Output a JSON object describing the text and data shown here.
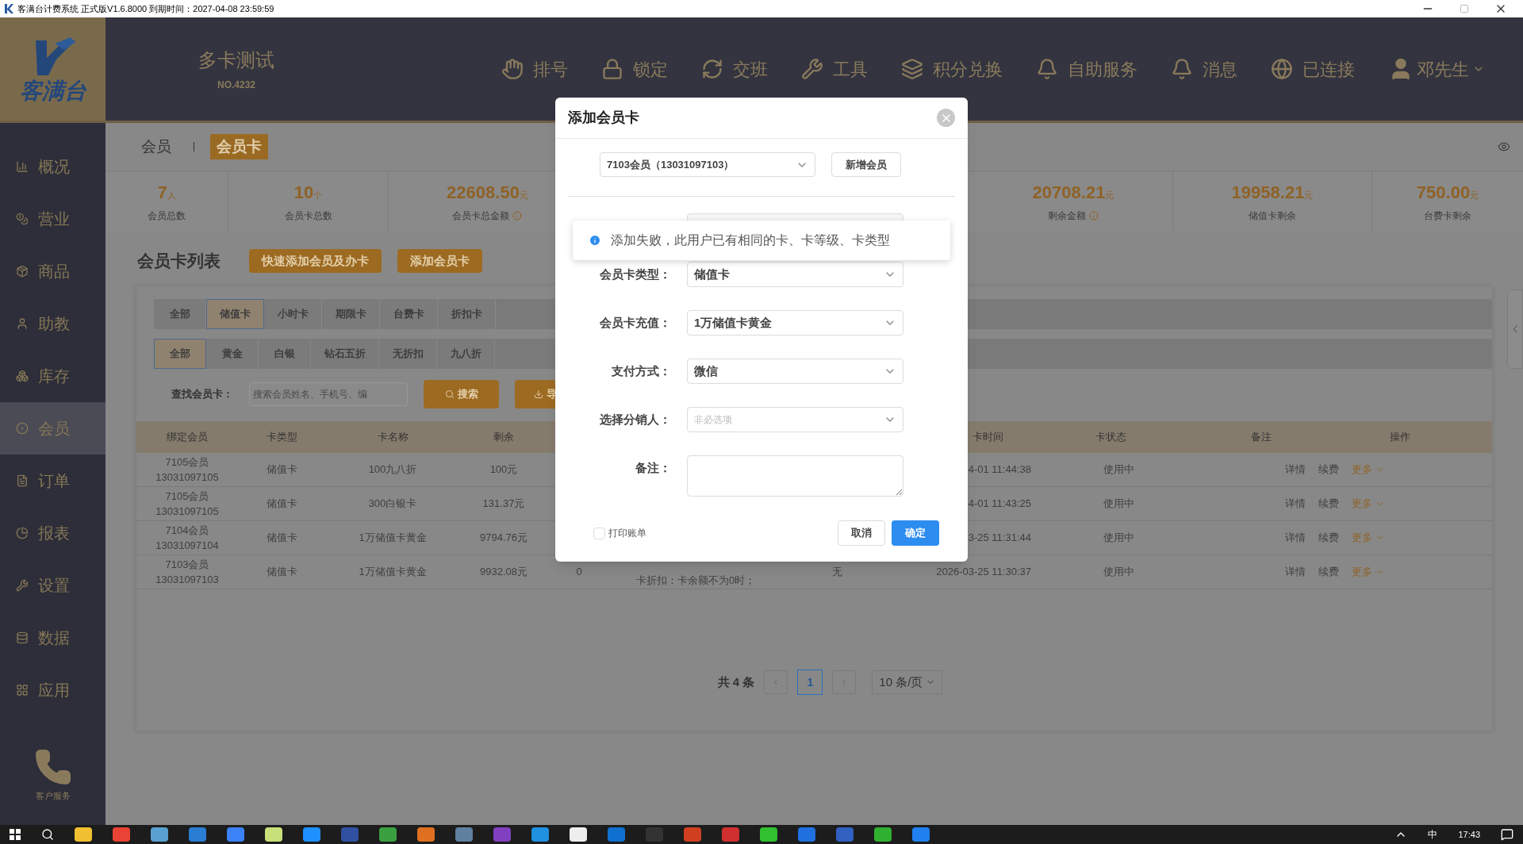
{
  "title_bar": {
    "title": "客满台计费系统 正式版V1.6.8000 到期时间：2027-04-08 23:59:59"
  },
  "header": {
    "logo_text": "客满台",
    "store_name": "多卡测试",
    "store_no": "NO.4232",
    "nav": [
      "排号",
      "锁定",
      "交班",
      "工具",
      "积分兑换",
      "自助服务",
      "消息",
      "已连接"
    ],
    "user": "邓先生"
  },
  "sidebar": {
    "items": [
      {
        "label": "概况",
        "selected": false
      },
      {
        "label": "营业",
        "selected": false
      },
      {
        "label": "商品",
        "selected": false
      },
      {
        "label": "助教",
        "selected": false
      },
      {
        "label": "库存",
        "selected": false
      },
      {
        "label": "会员",
        "selected": true
      },
      {
        "label": "订单",
        "selected": false
      },
      {
        "label": "报表",
        "selected": false
      },
      {
        "label": "设置",
        "selected": false
      },
      {
        "label": "数据",
        "selected": false
      },
      {
        "label": "应用",
        "selected": false
      }
    ],
    "service_label": "客户服务"
  },
  "tabs": [
    {
      "label": "会员",
      "selected": false
    },
    {
      "label": "会员卡",
      "selected": true
    }
  ],
  "stats_left": [
    {
      "value": "7",
      "unit": "人",
      "label": "会员总数",
      "info": false
    },
    {
      "value": "10",
      "unit": "个",
      "label": "会员卡总数",
      "info": false
    },
    {
      "value": "22608.50",
      "unit": "元",
      "label": "会员卡总金额",
      "info": true
    }
  ],
  "stats_right": [
    {
      "value": "20708.21",
      "unit": "元",
      "label": "剩余金额",
      "info": true
    },
    {
      "value": "19958.21",
      "unit": "元",
      "label": "储值卡剩余",
      "info": false
    },
    {
      "value": "750.00",
      "unit": "元",
      "label": "台费卡剩余",
      "info": false
    }
  ],
  "list_title": "会员卡列表",
  "actions": [
    "快速添加会员及办卡",
    "添加会员卡"
  ],
  "card_types": [
    {
      "label": "全部",
      "selected": false
    },
    {
      "label": "储值卡",
      "selected": true
    },
    {
      "label": "小时卡",
      "selected": false
    },
    {
      "label": "期限卡",
      "selected": false
    },
    {
      "label": "台费卡",
      "selected": false
    },
    {
      "label": "折扣卡",
      "selected": false
    }
  ],
  "card_levels": [
    {
      "label": "全部",
      "selected": true
    },
    {
      "label": "黄金",
      "selected": false
    },
    {
      "label": "白银",
      "selected": false
    },
    {
      "label": "钻石五折",
      "selected": false
    },
    {
      "label": "无折扣",
      "selected": false
    },
    {
      "label": "九八折",
      "selected": false
    }
  ],
  "search": {
    "label": "查找会员卡：",
    "placeholder": "搜索会员姓名、手机号、编",
    "button": "搜索",
    "export": "导"
  },
  "table": {
    "columns": {
      "member": "绑定会员",
      "type": "卡类型",
      "name": "卡名称",
      "balance": "剩余",
      "open_time": "卡时间",
      "status": "卡状态",
      "note": "备注",
      "ops": "操作"
    },
    "rows": [
      {
        "member": "7105会员",
        "phone": "13031097105",
        "type": "储值卡",
        "name": "100九八折",
        "balance": "100元",
        "open_time": "4-01 11:44:38",
        "status": "使用中",
        "ops": [
          "详情",
          "续费",
          "更多"
        ]
      },
      {
        "member": "7105会员",
        "phone": "13031097105",
        "type": "储值卡",
        "name": "300白银卡",
        "balance": "131.37元",
        "open_time": "4-01 11:43:25",
        "status": "使用中",
        "ops": [
          "详情",
          "续费",
          "更多"
        ]
      },
      {
        "member": "7104会员",
        "phone": "13031097104",
        "type": "储值卡",
        "name": "1万储值卡黄金",
        "balance": "9794.76元",
        "open_time": "3-25 11:31:44",
        "status": "使用中",
        "ops": [
          "详情",
          "续费",
          "更多"
        ]
      },
      {
        "member": "7103会员",
        "phone": "13031097103",
        "type": "储值卡",
        "name": "1万储值卡黄金",
        "balance": "9932.08元",
        "column_5": "0",
        "column_6": "卡折扣：卡余额不为0时；",
        "column_7": "无",
        "open_time": "2026-03-25 11:30:37",
        "status": "使用中",
        "ops": [
          "详情",
          "续费",
          "更多"
        ]
      }
    ]
  },
  "pagination": {
    "total": "共 4 条",
    "pages": [
      {
        "label": "1",
        "selected": true
      }
    ],
    "page_size": "10 条/页"
  },
  "dialog": {
    "title": "添加会员卡",
    "member": "7103会员（13031097103）",
    "new_member": "新增会员",
    "toast": "添加失败，此用户已有相同的卡、卡等级、卡类型",
    "fields": [
      {
        "kind": "select",
        "label": "会员卡类型：",
        "value": "储值卡"
      },
      {
        "kind": "select",
        "label": "会员卡充值：",
        "value": "1万储值卡黄金"
      },
      {
        "kind": "select",
        "label": "支付方式：",
        "value": "微信"
      },
      {
        "kind": "select",
        "label": "选择分销人：",
        "placeholder": "非必选项"
      },
      {
        "kind": "textarea",
        "label": "备注："
      }
    ],
    "print_bill": {
      "label": "打印账单",
      "checked": false
    },
    "cancel": "取消",
    "confirm": "确定"
  },
  "taskbar": {
    "ime": "中",
    "clock": "17:43"
  }
}
